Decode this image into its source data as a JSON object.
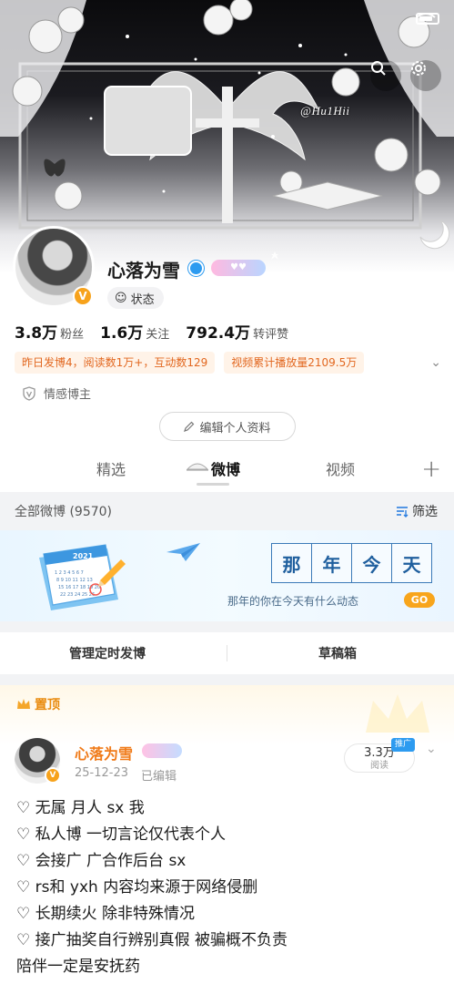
{
  "cover": {
    "watermark": "@Hu1Hii"
  },
  "profile": {
    "username": "心落为雪",
    "status_label": "状态",
    "stats": [
      {
        "value": "3.8万",
        "label": "粉丝"
      },
      {
        "value": "1.6万",
        "label": "关注"
      },
      {
        "value": "792.4万",
        "label": "转评赞"
      }
    ],
    "highlights": [
      "昨日发博4，阅读数1万+，互动数129",
      "视频累计播放量2109.5万"
    ],
    "tag": "情感博主",
    "edit_button": "编辑个人资料"
  },
  "tabs": [
    {
      "label": "精选",
      "active": false
    },
    {
      "label": "微博",
      "active": true
    },
    {
      "label": "视频",
      "active": false
    }
  ],
  "filter": {
    "title": "全部微博 (9570)",
    "button": "筛选"
  },
  "banner": {
    "calendar_year": "2021",
    "title_chars": [
      "那",
      "年",
      "今",
      "天"
    ],
    "subtitle": "那年的你在今天有什么动态",
    "go_label": "GO"
  },
  "actions": {
    "scheduled": "管理定时发博",
    "drafts": "草稿箱"
  },
  "pinned_post": {
    "pin_label": "置顶",
    "user": "心落为雪",
    "date": "25-12-23",
    "edited": "已编辑",
    "reads_value": "3.3万",
    "reads_label": "阅读",
    "promo_tag": "推广",
    "lines": [
      "♡ 无属 月人 sx 我",
      "♡ 私人博 一切言论仅代表个人",
      "♡ 会接广  广合作后台 sx",
      "♡ rs和 yxh 内容均来源于网络侵删",
      "♡ 长期续火 除非特殊情况",
      "♡ 接广抽奖自行辨别真假 被骗概不负责",
      "陪伴一定是安抚药"
    ]
  },
  "colors": {
    "accent_orange": "#f07a18",
    "verified_blue": "#2d9bf0",
    "highlight_text": "#e2671f"
  }
}
